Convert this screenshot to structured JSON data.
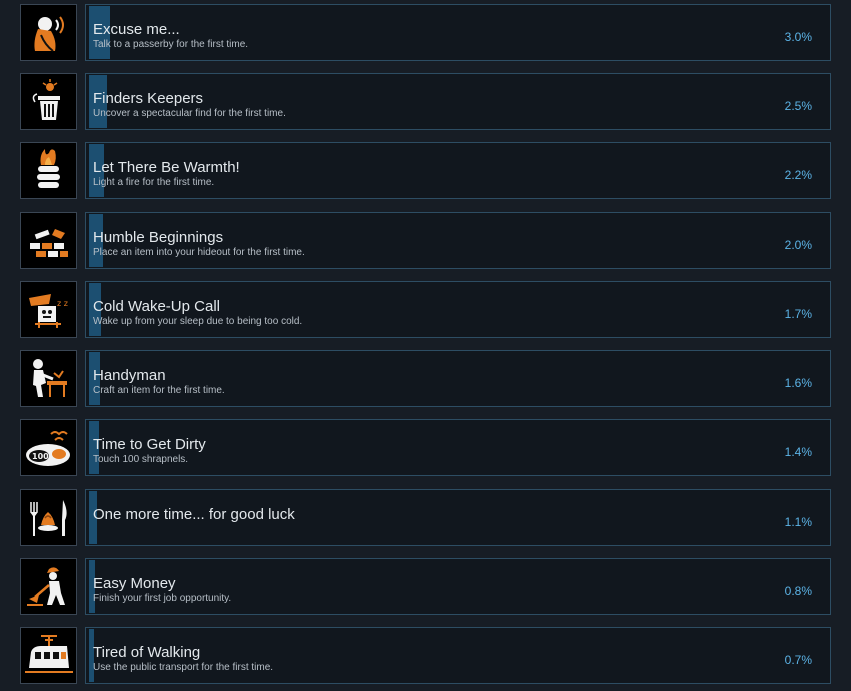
{
  "accent_color": "#5cb3e6",
  "achievements": [
    {
      "title": "Excuse me...",
      "description": "Talk to a passerby for the first time.",
      "percent": "3.0%",
      "percent_value": 3.0,
      "icon": "talking-person-icon"
    },
    {
      "title": "Finders Keepers",
      "description": "Uncover a spectacular find for the first time.",
      "percent": "2.5%",
      "percent_value": 2.5,
      "icon": "trash-can-find-icon"
    },
    {
      "title": "Let There Be Warmth!",
      "description": "Light a fire for the first time.",
      "percent": "2.2%",
      "percent_value": 2.2,
      "icon": "fire-barrel-icon"
    },
    {
      "title": "Humble Beginnings",
      "description": "Place an item into your hideout for the first time.",
      "percent": "2.0%",
      "percent_value": 2.0,
      "icon": "bricks-icon"
    },
    {
      "title": "Cold Wake-Up Call",
      "description": "Wake up from your sleep due to being too cold.",
      "percent": "1.7%",
      "percent_value": 1.7,
      "icon": "sleeping-cold-icon"
    },
    {
      "title": "Handyman",
      "description": "Craft an item for the first time.",
      "percent": "1.6%",
      "percent_value": 1.6,
      "icon": "workbench-icon"
    },
    {
      "title": "Time to Get Dirty",
      "description": "Touch 100 shrapnels.",
      "percent": "1.4%",
      "percent_value": 1.4,
      "icon": "shrapnel-100-icon"
    },
    {
      "title": "One more time... for good luck",
      "description": "",
      "percent": "1.1%",
      "percent_value": 1.1,
      "icon": "plate-fork-knife-icon"
    },
    {
      "title": "Easy Money",
      "description": "Finish your first job opportunity.",
      "percent": "0.8%",
      "percent_value": 0.8,
      "icon": "digging-worker-icon"
    },
    {
      "title": "Tired of Walking",
      "description": "Use the public transport for the first time.",
      "percent": "0.7%",
      "percent_value": 0.7,
      "icon": "tram-icon"
    }
  ]
}
